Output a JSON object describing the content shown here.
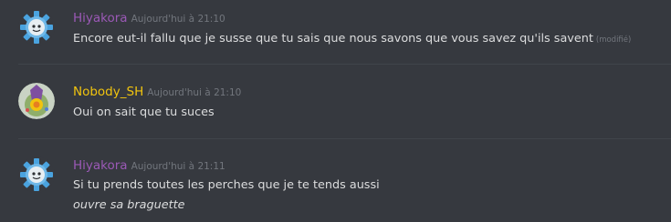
{
  "messages": [
    {
      "author": "Hiyakora",
      "author_color": "#9b59b6",
      "avatar": "hiyakora-gear-avatar-icon",
      "timestamp": "Aujourd'hui à 21:10",
      "lines": [
        {
          "text": "Encore eut-il fallu que je susse que tu sais que nous savons que vous savez qu'ils savent",
          "edited_label": "(modifié)"
        }
      ]
    },
    {
      "author": "Nobody_SH",
      "author_color": "#f1c40f",
      "avatar": "nobody-sh-avatar-icon",
      "timestamp": "Aujourd'hui à 21:10",
      "lines": [
        {
          "text": "Oui on sait que tu suces"
        }
      ]
    },
    {
      "author": "Hiyakora",
      "author_color": "#9b59b6",
      "avatar": "hiyakora-gear-avatar-icon",
      "timestamp": "Aujourd'hui à 21:11",
      "lines": [
        {
          "text": "Si tu prends toutes les perches que je te tends aussi"
        },
        {
          "text": "ouvre sa braguette",
          "italic": true
        }
      ]
    }
  ]
}
